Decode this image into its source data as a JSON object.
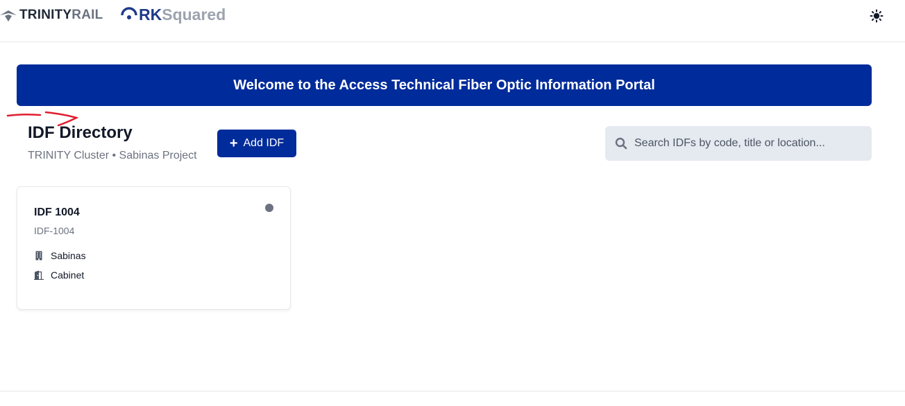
{
  "header": {
    "logo_trinity_part1": "TRINITY",
    "logo_trinity_part2": "RAIL",
    "logo_rk_part1": "RK",
    "logo_rk_part2": "Squared",
    "theme_icon": "sun-icon"
  },
  "banner": {
    "text": "Welcome to the Access Technical Fiber Optic Information Portal",
    "background": "#002b9a"
  },
  "directory": {
    "title": "IDF Directory",
    "subtitle": "TRINITY Cluster • Sabinas Project",
    "add_button": {
      "plus": "+",
      "label": "Add IDF"
    },
    "search": {
      "placeholder": "Search IDFs by code, title or location...",
      "value": ""
    }
  },
  "cards": [
    {
      "title": "IDF 1004",
      "code": "IDF-1004",
      "status_color": "#6b7280",
      "location": "Sabinas",
      "location_icon": "building-icon",
      "type": "Cabinet",
      "type_icon": "cabinet-icon"
    }
  ],
  "colors": {
    "primary": "#002b9a",
    "annotation": "#e11d2e"
  }
}
